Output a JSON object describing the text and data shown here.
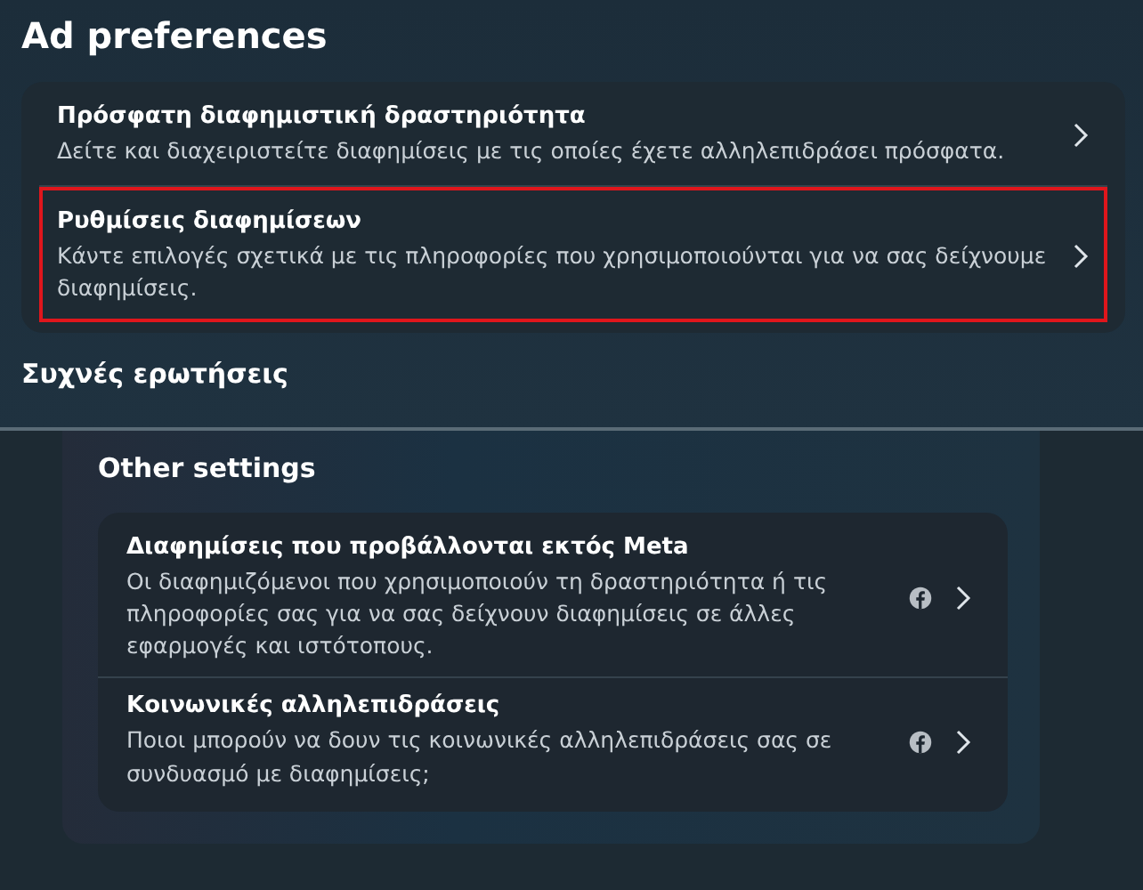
{
  "page": {
    "title": "Ad preferences"
  },
  "items": [
    {
      "title": "Πρόσφατη διαφημιστική δραστηριότητα",
      "description": "Δείτε και διαχειριστείτε διαφημίσεις με τις οποίες έχετε αλληλεπιδράσει πρόσφατα.",
      "highlighted": false
    },
    {
      "title": "Ρυθμίσεις διαφημίσεων",
      "description": "Κάντε επιλογές σχετικά με τις πληροφορίες που χρησιμοποιούνται για να σας δείχνουμε διαφημίσεις.",
      "highlighted": true
    }
  ],
  "faq_heading": "Συχνές ερωτήσεις",
  "other_settings": {
    "title": "Other settings",
    "items": [
      {
        "title": "Διαφημίσεις που προβάλλονται εκτός Meta",
        "description": "Οι διαφημιζόμενοι που χρησιμοποιούν τη δραστηριότητα ή τις πληροφορίες σας για να σας δείχνουν διαφημίσεις σε άλλες εφαρμογές και ιστότοπους."
      },
      {
        "title": "Κοινωνικές αλληλεπιδράσεις",
        "description": "Ποιοι μπορούν να δουν τις κοινωνικές αλληλεπιδράσεις σας σε συνδυασμό με διαφημίσεις;"
      }
    ]
  }
}
